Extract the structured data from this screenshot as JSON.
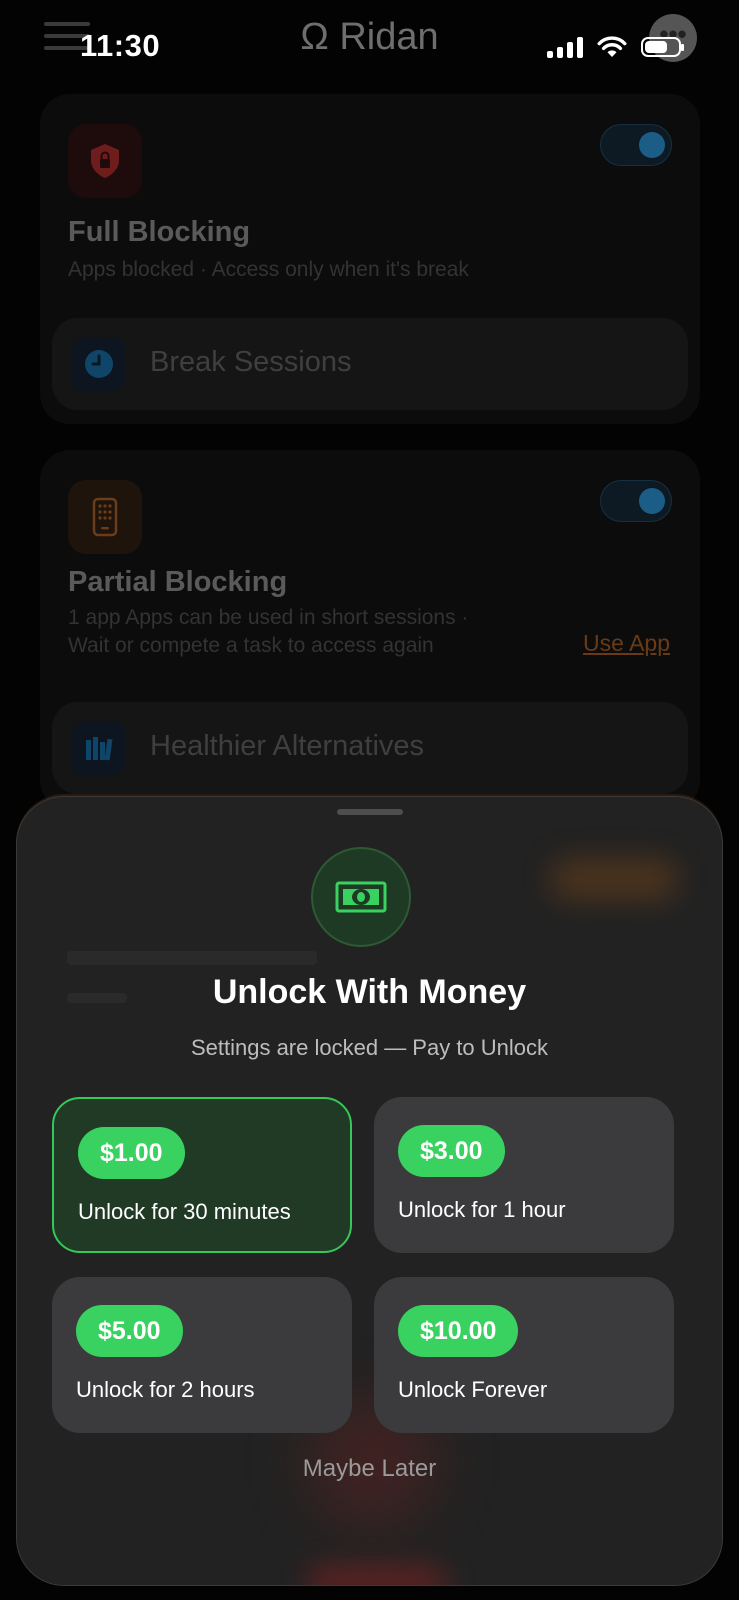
{
  "status_bar": {
    "time": "11:30"
  },
  "header": {
    "app_icon_symbol": "Ω",
    "app_name": "Ridan"
  },
  "cards": [
    {
      "icon": "shield-lock-icon",
      "title": "Full Blocking",
      "subtitle": "Apps blocked · Access only when it's break",
      "toggle_on": true,
      "row": {
        "icon": "clock-icon",
        "label": "Break Sessions"
      }
    },
    {
      "icon": "phone-keypad-icon",
      "title": "Partial Blocking",
      "subtitle_line1": "1 app Apps can be used in short sessions ·",
      "subtitle_line2": "Wait or compete a task to access again",
      "link": "Use App",
      "toggle_on": true,
      "row": {
        "icon": "books-icon",
        "label": "Healthier Alternatives"
      }
    }
  ],
  "sheet": {
    "icon": "banknote-icon",
    "title": "Unlock With Money",
    "subtitle": "Settings are locked — Pay to Unlock",
    "options": [
      {
        "price": "$1.00",
        "label": "Unlock for 30 minutes",
        "selected": true
      },
      {
        "price": "$3.00",
        "label": "Unlock for 1 hour",
        "selected": false
      },
      {
        "price": "$5.00",
        "label": "Unlock for 2 hours",
        "selected": false
      },
      {
        "price": "$10.00",
        "label": "Unlock Forever",
        "selected": false
      }
    ],
    "dismiss": "Maybe Later"
  },
  "colors": {
    "accent_green": "#39d260",
    "selected_border": "#34c759",
    "sheet_bg": "#222222"
  }
}
